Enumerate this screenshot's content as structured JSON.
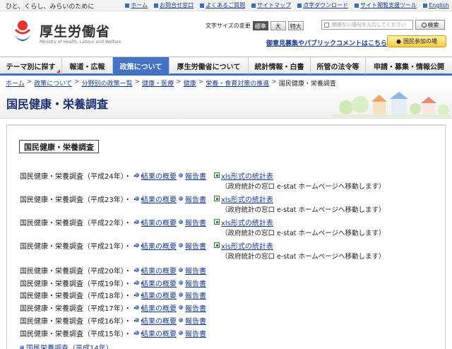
{
  "header": {
    "tagline": "ひと、くらし、みらいのために",
    "utility_links": [
      "ホーム",
      "お問合せ窓口",
      "よくあるご質問",
      "サイトマップ",
      "点字ダウンロード",
      "サイト閲覧支援ツール",
      "English"
    ],
    "logo_text": "厚生労働省",
    "logo_sub": "Ministry of Health, Labour and Welfare",
    "fontsize_label": "文字サイズの変更",
    "fontsize_options": [
      "標準",
      "大",
      "特大"
    ],
    "search_placeholder": "関係ない語句を入力してください",
    "search_button": "検索",
    "opinion_link": "御意見募集やパブリックコメントはこちら",
    "kokumin_button": "国民参加の場"
  },
  "nav": {
    "items": [
      "テーマ別に探す",
      "報道・広報",
      "政策について",
      "厚生労働省について",
      "統計情報・白書",
      "所管の法令等",
      "申請・募集・情報公開"
    ],
    "active_index": 2
  },
  "breadcrumb": [
    "ホーム",
    "政策について",
    "分野別の政策一覧",
    "健康・医療",
    "健康",
    "栄養・食育対策の推進",
    "国民健康・栄養調査"
  ],
  "page": {
    "title": "国民健康・栄養調査",
    "section_heading": "国民健康・栄養調査"
  },
  "survey": {
    "link_summary": "結果の概要",
    "link_report": "報告書",
    "link_xls": "xls形式の統計表",
    "xls_note": "（政府統計の窓口 e-stat ホームページへ移動します）",
    "rows": [
      {
        "label": "国民健康・栄養調査（平成24年）・・・",
        "has_xls": true
      },
      {
        "label": "国民健康・栄養調査（平成23年）・・・",
        "has_xls": true
      },
      {
        "label": "国民健康・栄養調査（平成22年）・・・",
        "has_xls": true
      },
      {
        "label": "国民健康・栄養調査（平成21年）・・・",
        "has_xls": true
      },
      {
        "label": "国民健康・栄養調査（平成20年）・・・",
        "has_xls": false
      },
      {
        "label": "国民健康・栄養調査（平成19年）・・・",
        "has_xls": false
      },
      {
        "label": "国民健康・栄養調査（平成18年）・・・",
        "has_xls": false
      },
      {
        "label": "国民健康・栄養調査（平成17年）・・・",
        "has_xls": false
      },
      {
        "label": "国民健康・栄養調査（平成16年）・・・",
        "has_xls": false
      },
      {
        "label": "国民健康・栄養調査（平成15年）・・・",
        "has_xls": false
      }
    ],
    "last_link": "国民栄養調査（平成14年）"
  },
  "colors": {
    "nav_active": "#4472c4",
    "link": "#1a3b8c",
    "title": "#1b2f6e"
  }
}
